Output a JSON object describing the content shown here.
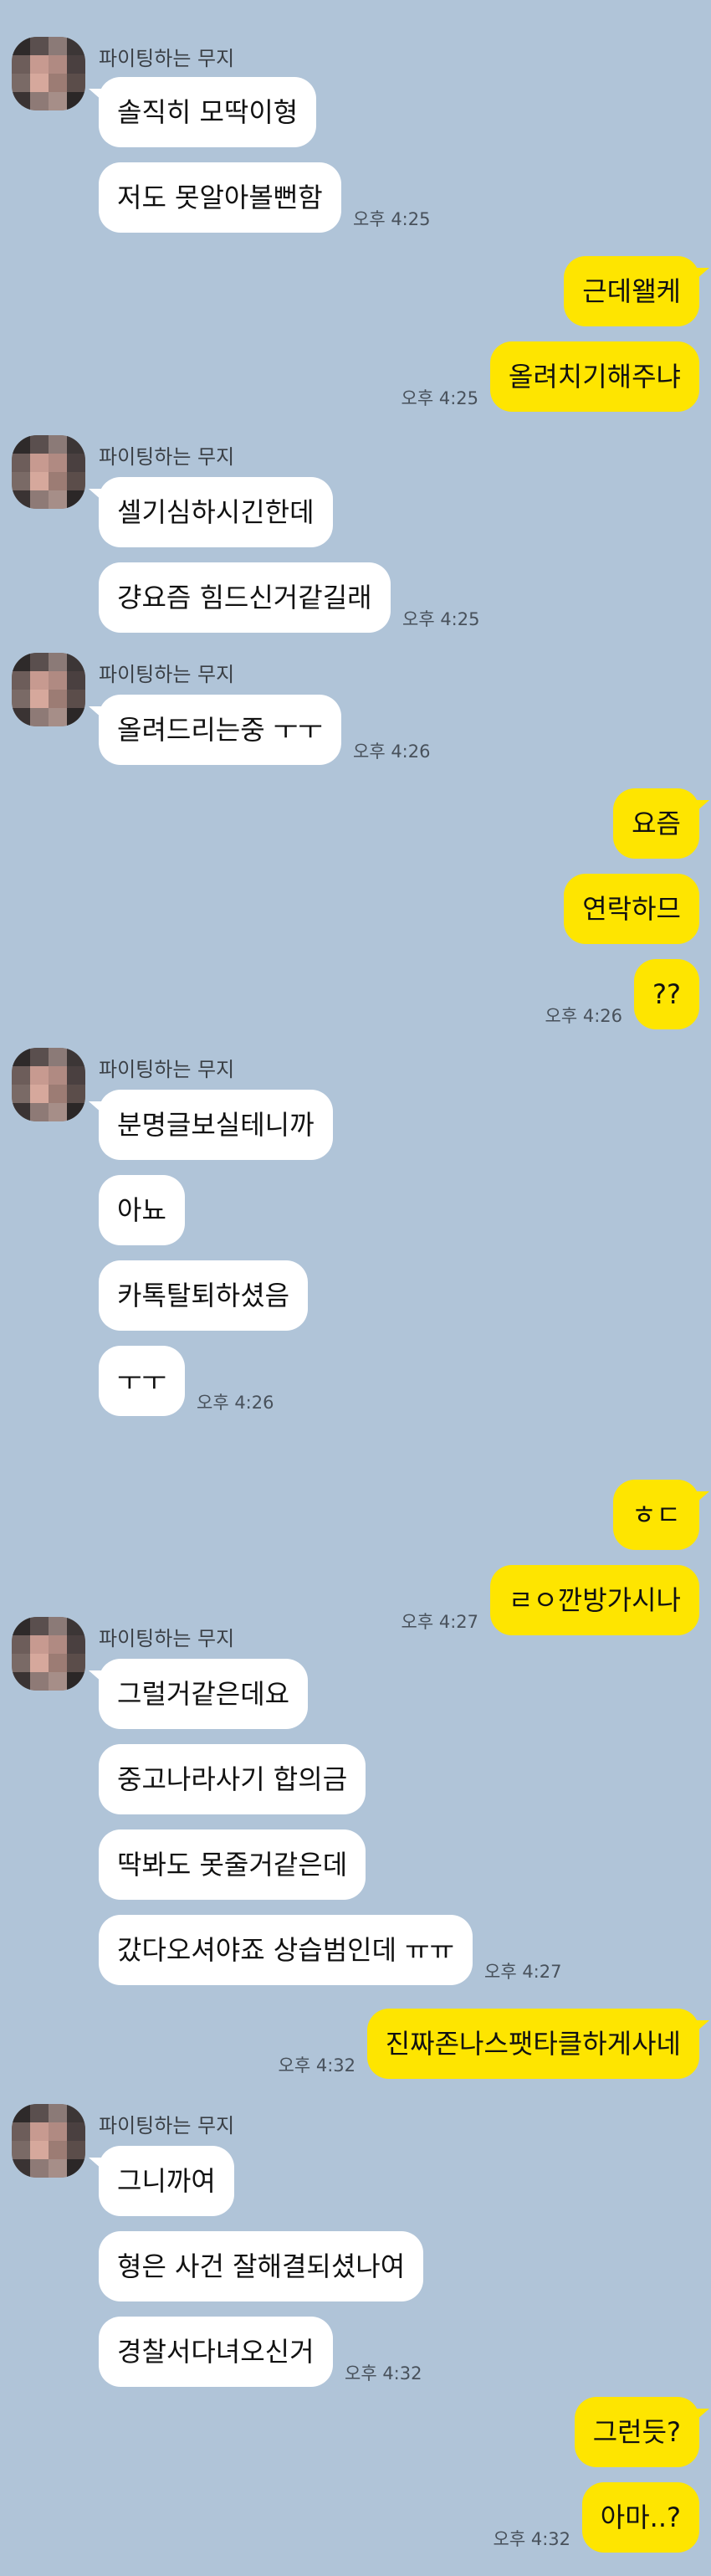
{
  "chat": {
    "sender_name": "파이팅하는 무지",
    "messages": [
      {
        "side": "in",
        "text": "솔직히 모딱이형",
        "time": ""
      },
      {
        "side": "in",
        "text": "저도 못알아볼뻔함",
        "time": "오후 4:25"
      },
      {
        "side": "out",
        "text": "근데왤케",
        "time": ""
      },
      {
        "side": "out",
        "text": "올려치기해주냐",
        "time": "오후 4:25"
      },
      {
        "side": "in",
        "text": "셀기심하시긴한데",
        "time": ""
      },
      {
        "side": "in",
        "text": "걍요즘 힘드신거같길래",
        "time": "오후 4:25"
      },
      {
        "side": "in",
        "text": "올려드리는중 ㅜㅜ",
        "time": "오후 4:26"
      },
      {
        "side": "out",
        "text": "요즘",
        "time": ""
      },
      {
        "side": "out",
        "text": "연락하므",
        "time": ""
      },
      {
        "side": "out",
        "text": "??",
        "time": "오후 4:26"
      },
      {
        "side": "in",
        "text": "분명글보실테니까",
        "time": ""
      },
      {
        "side": "in",
        "text": "아뇨",
        "time": ""
      },
      {
        "side": "in",
        "text": "카톡탈퇴하셨음",
        "time": ""
      },
      {
        "side": "in",
        "text": "ㅜㅜ",
        "time": "오후 4:26"
      },
      {
        "side": "out",
        "text": "ㅎㄷ",
        "time": ""
      },
      {
        "side": "out",
        "text": "ㄹㅇ깐방가시나",
        "time": "오후 4:27"
      },
      {
        "side": "in",
        "text": "그럴거같은데요",
        "time": ""
      },
      {
        "side": "in",
        "text": "중고나라사기 합의금",
        "time": ""
      },
      {
        "side": "in",
        "text": "딱봐도 못줄거같은데",
        "time": ""
      },
      {
        "side": "in",
        "text": "갔다오셔야죠 상습범인데 ㅠㅠ",
        "time": "오후 4:27"
      },
      {
        "side": "out",
        "text": "진짜존나스팻타클하게사네",
        "time": "오후 4:32"
      },
      {
        "side": "in",
        "text": "그니까여",
        "time": ""
      },
      {
        "side": "in",
        "text": "형은 사건 잘해결되셨나여",
        "time": ""
      },
      {
        "side": "in",
        "text": "경찰서다녀오신거",
        "time": "오후 4:32"
      },
      {
        "side": "out",
        "text": "그런듯?",
        "time": ""
      },
      {
        "side": "out",
        "text": "아마..?",
        "time": "오후 4:32"
      }
    ]
  }
}
